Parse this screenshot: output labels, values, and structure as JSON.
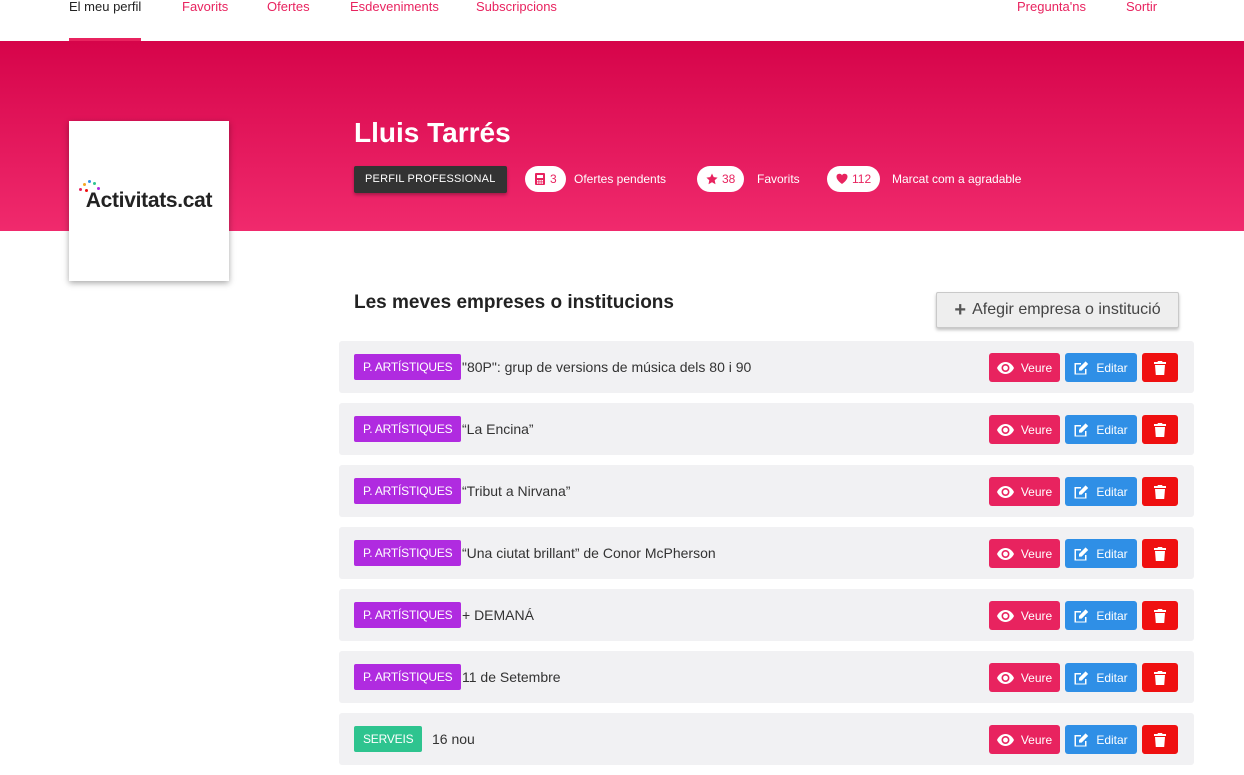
{
  "nav": {
    "items": [
      {
        "label": "El meu perfil",
        "active": true
      },
      {
        "label": "Favorits",
        "active": false
      },
      {
        "label": "Ofertes",
        "active": false
      },
      {
        "label": "Esdeveniments",
        "active": false
      },
      {
        "label": "Subscripcions",
        "active": false
      }
    ],
    "right": [
      {
        "label": "Pregunta'ns"
      },
      {
        "label": "Sortir"
      }
    ]
  },
  "logo": {
    "text": "Activitats.cat"
  },
  "profile": {
    "name": "Lluis Tarrés",
    "badge": "PERFIL PROFESSIONAL",
    "stats": [
      {
        "icon": "calculator-icon",
        "count": "3",
        "label": "Ofertes pendents"
      },
      {
        "icon": "star-icon",
        "count": "38",
        "label": "Favorits"
      },
      {
        "icon": "heart-icon",
        "count": "112",
        "label": "Marcat com a agradable"
      }
    ]
  },
  "section": {
    "title": "Les meves empreses o institucions",
    "add_label": "Afegir empresa o institució"
  },
  "actions": {
    "view": "Veure",
    "edit": "Editar"
  },
  "rows": [
    {
      "category": "P. ARTÍSTIQUES",
      "type": "art",
      "title": "\"80P\": grup de versions de música dels 80 i 90"
    },
    {
      "category": "P. ARTÍSTIQUES",
      "type": "art",
      "title": "“La Encina”"
    },
    {
      "category": "P. ARTÍSTIQUES",
      "type": "art",
      "title": "“Tribut a Nirvana”"
    },
    {
      "category": "P. ARTÍSTIQUES",
      "type": "art",
      "title": "“Una ciutat brillant” de Conor McPherson"
    },
    {
      "category": "P. ARTÍSTIQUES",
      "type": "art",
      "title": "+ DEMANÁ"
    },
    {
      "category": "P. ARTÍSTIQUES",
      "type": "art",
      "title": "11 de Setembre"
    },
    {
      "category": "SERVEIS",
      "type": "serv",
      "title": "16 nou"
    }
  ],
  "colors": {
    "brand": "#e8235f",
    "edit": "#2f8fe6",
    "delete": "#ef1010",
    "artistic": "#b02be0",
    "services": "#2ec48f"
  }
}
